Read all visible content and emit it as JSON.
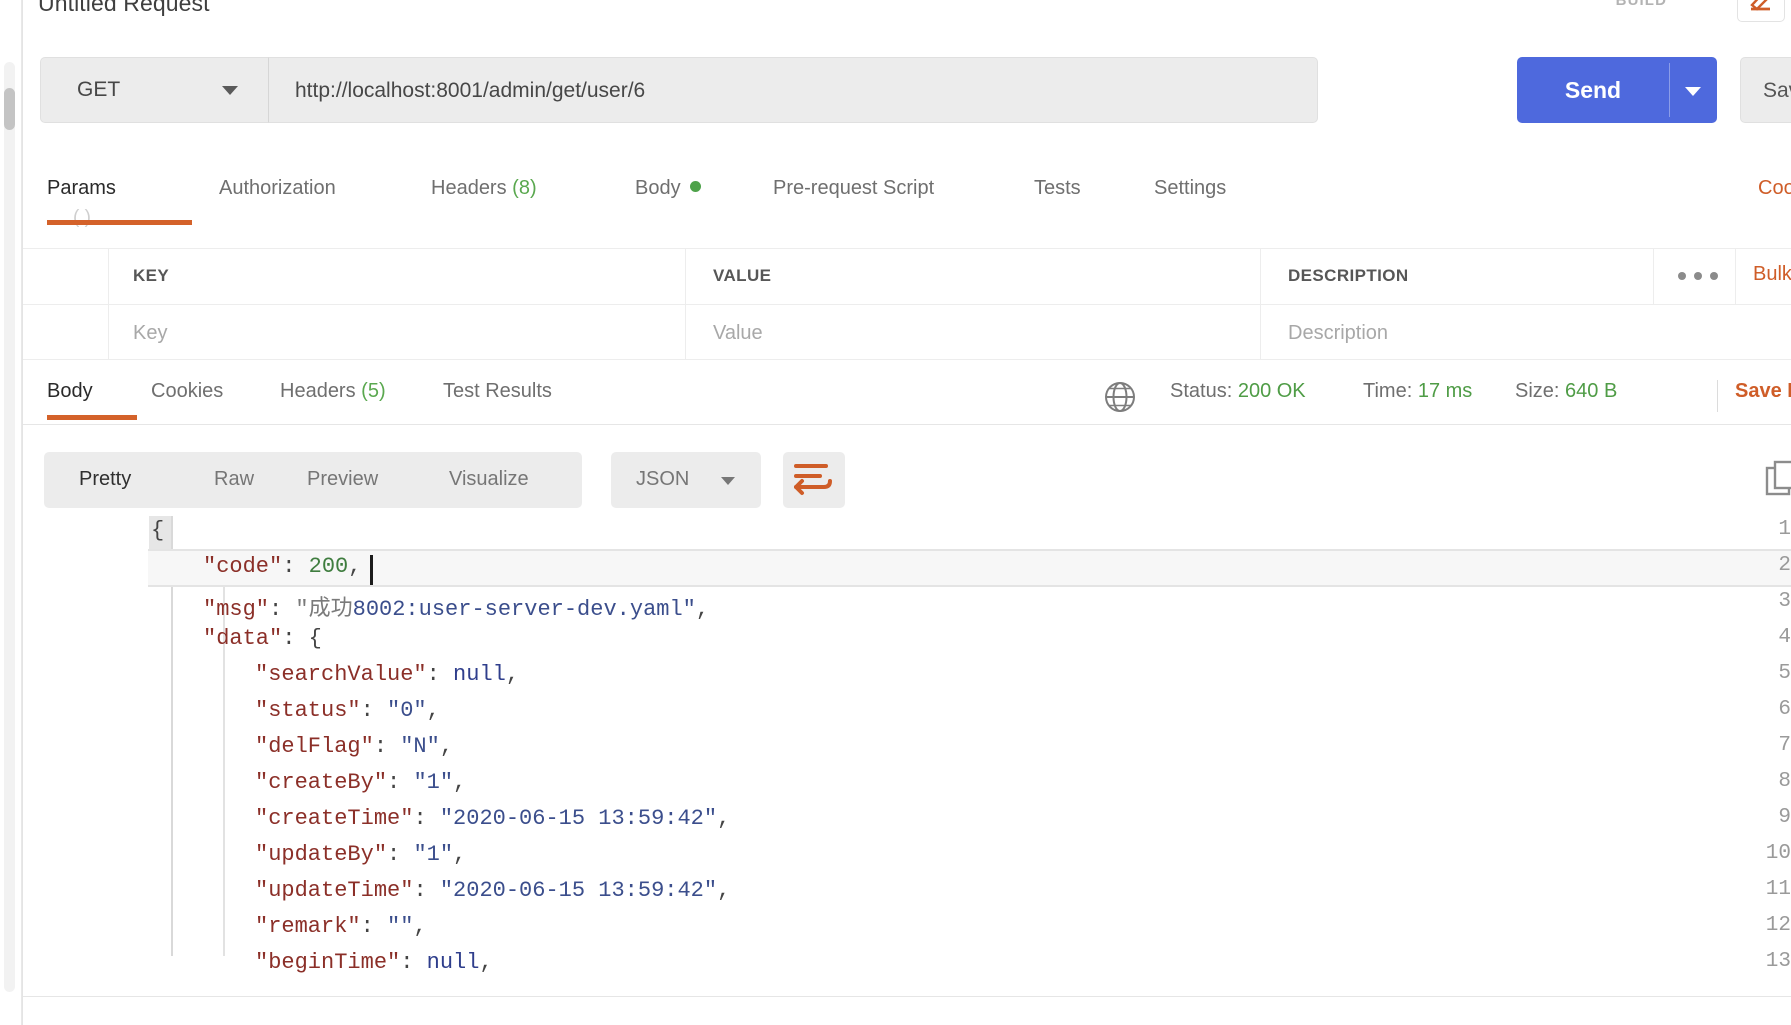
{
  "request": {
    "title": "Untitled Request",
    "build_label": "BUILD",
    "build_icon": "pen-edit-icon",
    "method": "GET",
    "url": "http://localhost:8001/admin/get/user/6",
    "send_label": "Send",
    "save_label": "Save",
    "ghost_sub": "( )"
  },
  "request_tabs": [
    {
      "label": "Params",
      "count": "",
      "active": true,
      "dot": false
    },
    {
      "label": "Authorization",
      "count": "",
      "active": false,
      "dot": false
    },
    {
      "label": "Headers",
      "count": "(8)",
      "active": false,
      "dot": false
    },
    {
      "label": "Body",
      "count": "",
      "active": false,
      "dot": true
    },
    {
      "label": "Pre-request Script",
      "count": "",
      "active": false,
      "dot": false
    },
    {
      "label": "Tests",
      "count": "",
      "active": false,
      "dot": false
    },
    {
      "label": "Settings",
      "count": "",
      "active": false,
      "dot": false
    }
  ],
  "cookies_link": "Cookies",
  "params_table": {
    "headers": [
      "KEY",
      "VALUE",
      "DESCRIPTION"
    ],
    "row_placeholders": [
      "Key",
      "Value",
      "Description"
    ],
    "more_icon": "ellipsis-icon",
    "bulk_edit": "Bulk"
  },
  "response_tabs": [
    {
      "label": "Body",
      "count": "",
      "active": true
    },
    {
      "label": "Cookies",
      "count": "",
      "active": false
    },
    {
      "label": "Headers",
      "count": "(5)",
      "active": false
    },
    {
      "label": "Test Results",
      "count": "",
      "active": false
    }
  ],
  "response_status": {
    "globe_icon": "globe-icon",
    "status_label": "Status:",
    "status_value": "200 OK",
    "time_label": "Time:",
    "time_value": "17 ms",
    "size_label": "Size:",
    "size_value": "640 B",
    "save_response": "Save Respo"
  },
  "viewer_toolbar": {
    "modes": [
      "Pretty",
      "Raw",
      "Preview",
      "Visualize"
    ],
    "active_mode": "Pretty",
    "format": "JSON",
    "wrap_icon": "word-wrap-icon",
    "copy_icon": "copy-icon"
  },
  "code": {
    "lines": [
      {
        "num": "1",
        "indent": 0,
        "tokens": [
          {
            "t": "p",
            "v": "{"
          }
        ]
      },
      {
        "num": "2",
        "indent": 1,
        "tokens": [
          {
            "t": "k",
            "v": "\"code\""
          },
          {
            "t": "p",
            "v": ": "
          },
          {
            "t": "n",
            "v": "200"
          },
          {
            "t": "p",
            "v": ","
          }
        ]
      },
      {
        "num": "3",
        "indent": 1,
        "tokens": [
          {
            "t": "k",
            "v": "\"msg\""
          },
          {
            "t": "p",
            "v": ": "
          },
          {
            "t": "cn",
            "v": "\"成功"
          },
          {
            "t": "s",
            "v": "8002:user-server-dev.yaml\""
          },
          {
            "t": "p",
            "v": ","
          }
        ]
      },
      {
        "num": "4",
        "indent": 1,
        "tokens": [
          {
            "t": "k",
            "v": "\"data\""
          },
          {
            "t": "p",
            "v": ": {"
          }
        ]
      },
      {
        "num": "5",
        "indent": 2,
        "tokens": [
          {
            "t": "k",
            "v": "\"searchValue\""
          },
          {
            "t": "p",
            "v": ": "
          },
          {
            "t": "nl",
            "v": "null"
          },
          {
            "t": "p",
            "v": ","
          }
        ]
      },
      {
        "num": "6",
        "indent": 2,
        "tokens": [
          {
            "t": "k",
            "v": "\"status\""
          },
          {
            "t": "p",
            "v": ": "
          },
          {
            "t": "s",
            "v": "\"0\""
          },
          {
            "t": "p",
            "v": ","
          }
        ]
      },
      {
        "num": "7",
        "indent": 2,
        "tokens": [
          {
            "t": "k",
            "v": "\"delFlag\""
          },
          {
            "t": "p",
            "v": ": "
          },
          {
            "t": "s",
            "v": "\"N\""
          },
          {
            "t": "p",
            "v": ","
          }
        ]
      },
      {
        "num": "8",
        "indent": 2,
        "tokens": [
          {
            "t": "k",
            "v": "\"createBy\""
          },
          {
            "t": "p",
            "v": ": "
          },
          {
            "t": "s",
            "v": "\"1\""
          },
          {
            "t": "p",
            "v": ","
          }
        ]
      },
      {
        "num": "9",
        "indent": 2,
        "tokens": [
          {
            "t": "k",
            "v": "\"createTime\""
          },
          {
            "t": "p",
            "v": ": "
          },
          {
            "t": "s",
            "v": "\"2020-06-15 13:59:42\""
          },
          {
            "t": "p",
            "v": ","
          }
        ]
      },
      {
        "num": "10",
        "indent": 2,
        "tokens": [
          {
            "t": "k",
            "v": "\"updateBy\""
          },
          {
            "t": "p",
            "v": ": "
          },
          {
            "t": "s",
            "v": "\"1\""
          },
          {
            "t": "p",
            "v": ","
          }
        ]
      },
      {
        "num": "11",
        "indent": 2,
        "tokens": [
          {
            "t": "k",
            "v": "\"updateTime\""
          },
          {
            "t": "p",
            "v": ": "
          },
          {
            "t": "s",
            "v": "\"2020-06-15 13:59:42\""
          },
          {
            "t": "p",
            "v": ","
          }
        ]
      },
      {
        "num": "12",
        "indent": 2,
        "tokens": [
          {
            "t": "k",
            "v": "\"remark\""
          },
          {
            "t": "p",
            "v": ": "
          },
          {
            "t": "s",
            "v": "\"\""
          },
          {
            "t": "p",
            "v": ","
          }
        ]
      },
      {
        "num": "13",
        "indent": 2,
        "tokens": [
          {
            "t": "k",
            "v": "\"beginTime\""
          },
          {
            "t": "p",
            "v": ": "
          },
          {
            "t": "nl",
            "v": "null"
          },
          {
            "t": "p",
            "v": ","
          }
        ]
      }
    ],
    "cursor_line": 2
  },
  "colors": {
    "accent_orange": "#cf5d28",
    "send_blue": "#4e69dd",
    "status_green": "#4f9c46",
    "key_red": "#8b2f28",
    "string_blue": "#3b4e8c"
  }
}
